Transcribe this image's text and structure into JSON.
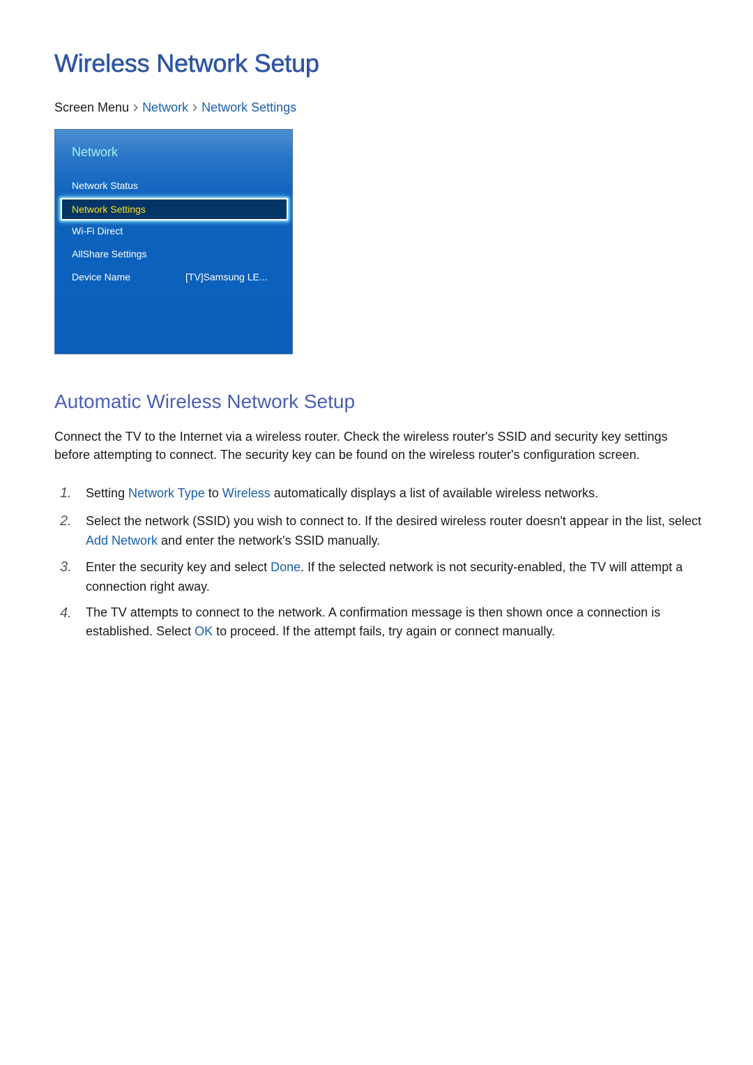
{
  "page": {
    "title": "Wireless Network Setup",
    "breadcrumb": {
      "root": "Screen Menu",
      "level1": "Network",
      "level2": "Network Settings"
    }
  },
  "tv_menu": {
    "title": "Network",
    "items": [
      {
        "label": "Network Status"
      },
      {
        "label": "Network Settings",
        "selected": true
      },
      {
        "label": "Wi-Fi Direct"
      },
      {
        "label": "AllShare Settings"
      },
      {
        "label": "Device Name",
        "value": "[TV]Samsung LE..."
      }
    ]
  },
  "section": {
    "heading": "Automatic Wireless Network Setup",
    "intro": "Connect the TV to the Internet via a wireless router. Check the wireless router's SSID and security key settings before attempting to connect. The security key can be found on the wireless router's configuration screen.",
    "steps": [
      {
        "num": "1.",
        "parts": [
          "Setting ",
          "Network Type",
          " to ",
          "Wireless",
          " automatically displays a list of available wireless networks."
        ]
      },
      {
        "num": "2.",
        "parts": [
          "Select the network (SSID) you wish to connect to. If the desired wireless router doesn't appear in the list, select ",
          "Add Network",
          " and enter the network's SSID manually."
        ]
      },
      {
        "num": "3.",
        "parts": [
          "Enter the security key and select ",
          "Done",
          ". If the selected network is not security-enabled, the TV will attempt a connection right away."
        ]
      },
      {
        "num": "4.",
        "parts": [
          "The TV attempts to connect to the network. A confirmation message is then shown once a connection is established. Select ",
          "OK",
          " to proceed. If the attempt fails, try again or connect manually."
        ]
      }
    ]
  },
  "colors": {
    "title": "#2f55a4",
    "heading": "#4a5fb3",
    "keyword": "#1a5fa8",
    "tv_selected_text": "#ffe21a",
    "tv_title_text": "#a8f0ee"
  }
}
